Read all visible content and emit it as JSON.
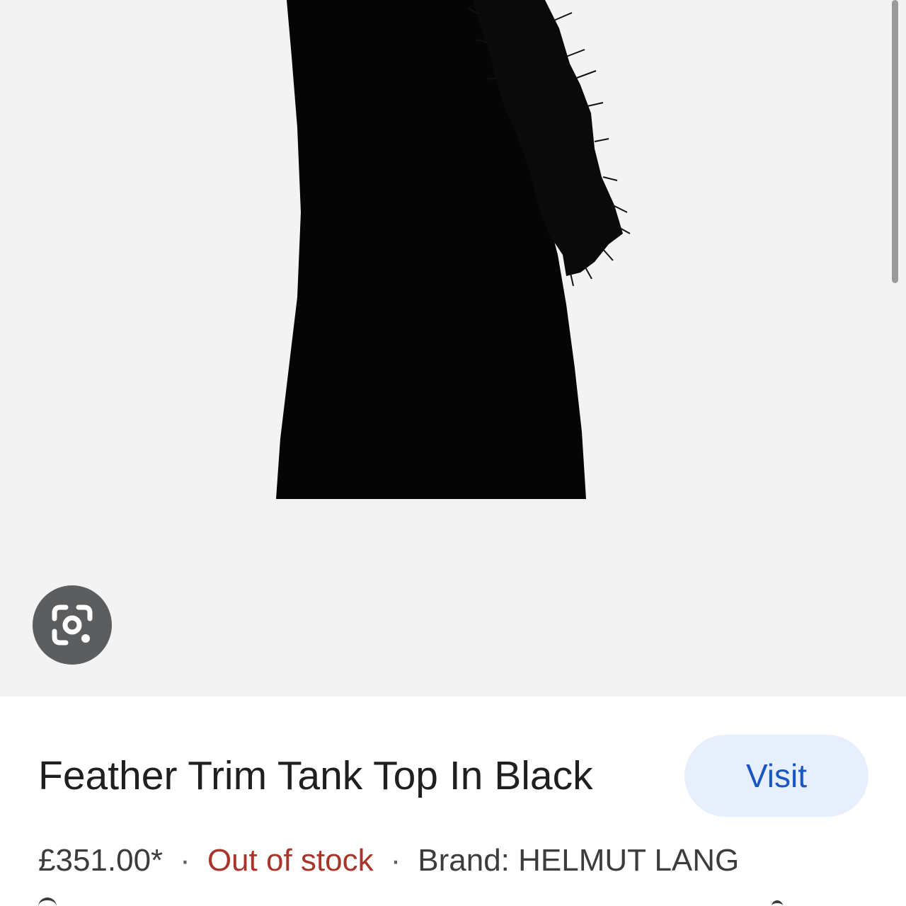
{
  "product": {
    "title": "Feather Trim Tank Top In Black",
    "price": "£351.00*",
    "separator": "·",
    "availability": "Out of stock",
    "brand": "Brand: HELMUT LANG"
  },
  "actions": {
    "visit_label": "Visit"
  },
  "icons": {
    "lens": "google-lens-icon"
  },
  "colors": {
    "image_background": "#f3f3f3",
    "visit_button_bg": "#e8effc",
    "visit_button_text": "#1a56c2",
    "out_of_stock": "#a8342a",
    "lens_button_bg": "#5c5d5f"
  }
}
